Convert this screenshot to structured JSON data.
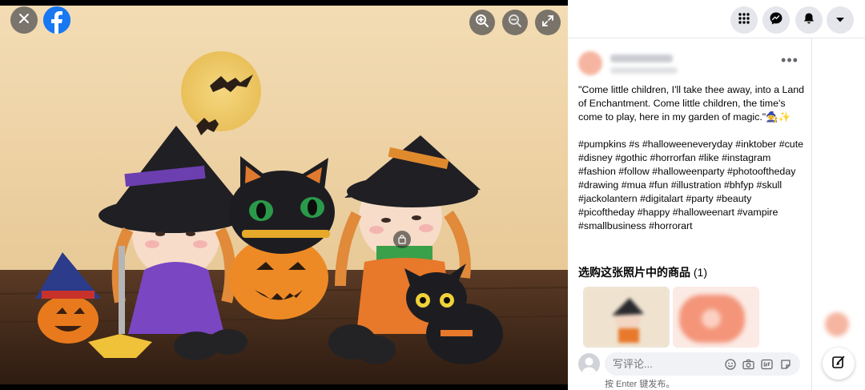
{
  "viewer": {
    "close_icon": "close-icon",
    "logo": "facebook-logo",
    "zoom_in_icon": "zoom-in-icon",
    "zoom_out_icon": "zoom-out-icon",
    "fullscreen_icon": "fullscreen-icon",
    "tag_icon": "shopping-bag-icon"
  },
  "topnav": {
    "menu_icon": "grid-menu-icon",
    "messenger_icon": "messenger-icon",
    "notifications_icon": "bell-icon",
    "account_icon": "chevron-down-icon"
  },
  "post": {
    "more_label": "•••",
    "caption": "\"Come little children, I'll take thee away, into a Land of Enchantment. Come little children, the time's come to play, here in my garden of magic.\"🧙✨\n\n#pumpkins #s #halloweeneveryday #inktober #cute #disney #gothic #horrorfan #like #instagram #fashion #follow #halloweenparty #photooftheday #drawing #mua #fun #illustration #bhfyp #skull #jackolantern #digitalart #party #beauty #picoftheday #happy #halloweenart #vampire #smallbusiness #horrorart",
    "shop_title": "选购这张照片中的商品",
    "shop_count": "(1)"
  },
  "comment": {
    "placeholder": "写评论...",
    "enter_hint": "按 Enter 键发布。",
    "icons": [
      "emoji-icon",
      "camera-icon",
      "gif-icon",
      "sticker-icon"
    ]
  },
  "colors": {
    "brand": "#1877f2",
    "panel_bg": "#ffffff",
    "input_bg": "#f0f2f5"
  }
}
